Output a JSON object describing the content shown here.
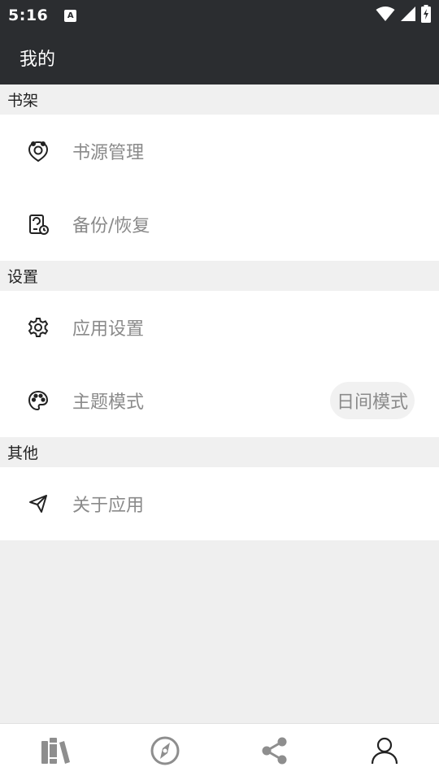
{
  "status_bar": {
    "time": "5:16",
    "notification_glyph": "A",
    "icons": [
      "wifi-icon",
      "cell-signal-icon",
      "battery-charging-icon"
    ]
  },
  "toolbar": {
    "title": "我的"
  },
  "sections": [
    {
      "header": "书架",
      "items": [
        {
          "label": "书源管理",
          "icon": "book-source-icon"
        },
        {
          "label": "备份/恢复",
          "icon": "backup-restore-icon"
        }
      ]
    },
    {
      "header": "设置",
      "items": [
        {
          "label": "应用设置",
          "icon": "gear-icon"
        },
        {
          "label": "主题模式",
          "icon": "palette-icon",
          "value": "日间模式"
        }
      ]
    },
    {
      "header": "其他",
      "items": [
        {
          "label": "关于应用",
          "icon": "paper-plane-icon"
        }
      ]
    }
  ],
  "bottom_nav": {
    "tabs": [
      {
        "name": "bookshelf",
        "icon": "bookshelf-icon"
      },
      {
        "name": "discover",
        "icon": "compass-icon"
      },
      {
        "name": "share",
        "icon": "share-icon"
      },
      {
        "name": "my",
        "icon": "user-icon",
        "active": true
      }
    ]
  },
  "colors": {
    "bar_background": "#2b2d30",
    "page_background": "#efefef",
    "item_label": "#8a8a8a",
    "icon": "#222222",
    "nav_inactive": "#8e8e8e",
    "nav_active": "#222222"
  }
}
